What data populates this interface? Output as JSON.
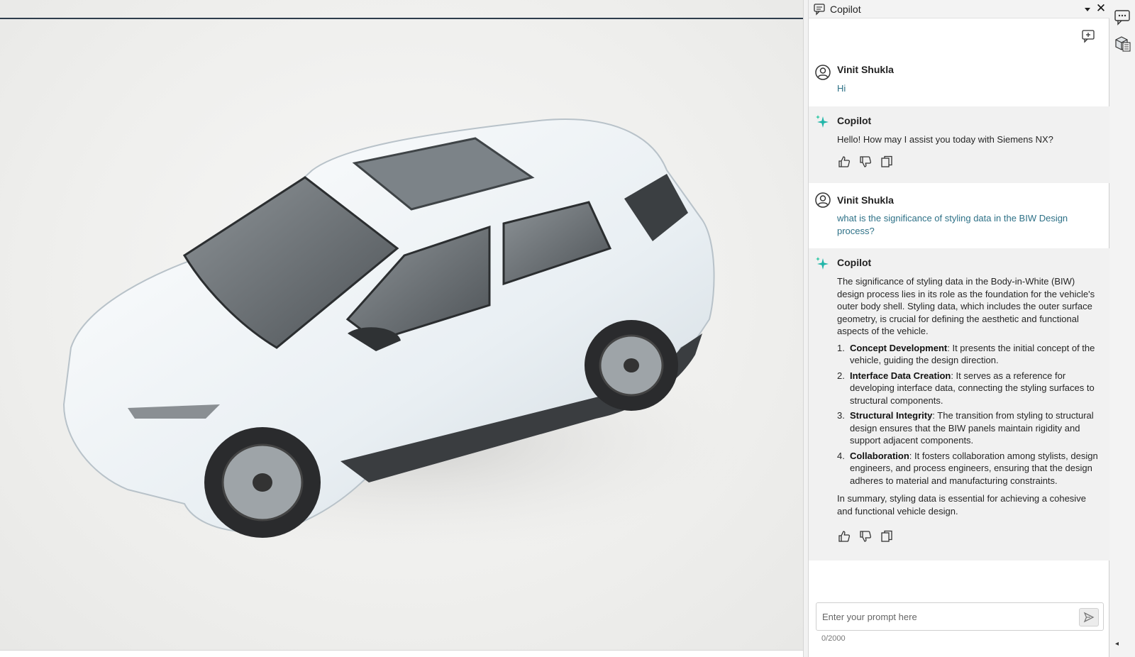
{
  "panel": {
    "title": "Copilot"
  },
  "messages": [
    {
      "role": "user",
      "name": "Vinit Shukla",
      "text": "Hi"
    },
    {
      "role": "bot",
      "name": "Copilot",
      "text": "Hello! How may I assist you today with Siemens NX?"
    },
    {
      "role": "user",
      "name": "Vinit Shukla",
      "text": "what is the significance of styling data in the BIW Design process?"
    },
    {
      "role": "bot",
      "name": "Copilot",
      "intro": "The significance of styling data in the Body-in-White (BIW) design process lies in its role as the foundation for the vehicle's outer body shell. Styling data, which includes the outer surface geometry, is crucial for defining the aesthetic and functional aspects of the vehicle.",
      "list": [
        {
          "num": "1.",
          "term": "Concept Development",
          "desc": ": It presents the initial concept of the vehicle, guiding the design direction."
        },
        {
          "num": "2.",
          "term": "Interface Data Creation",
          "desc": ": It serves as a reference for developing interface data, connecting the styling surfaces to structural components."
        },
        {
          "num": "3.",
          "term": "Structural Integrity",
          "desc": ": The transition from styling to structural design ensures that the BIW panels maintain rigidity and support adjacent components."
        },
        {
          "num": "4.",
          "term": "Collaboration",
          "desc": ": It fosters collaboration among stylists, design engineers, and process engineers, ensuring that the design adheres to material and manufacturing constraints."
        }
      ],
      "summary": "In summary, styling data is essential for achieving a cohesive and functional vehicle design."
    }
  ],
  "prompt": {
    "placeholder": "Enter your prompt here",
    "char_count": "0/2000"
  },
  "icons": {
    "header": "chat-icon",
    "dropdown": "chevron-down-icon",
    "close": "close-icon",
    "new_chat": "new-chat-icon",
    "user_avatar": "user-avatar-icon",
    "bot_avatar": "sparkle-icon",
    "like": "thumbs-up-icon",
    "dislike": "thumbs-down-icon",
    "copy": "copy-icon",
    "send": "send-icon",
    "rail": [
      "copilot-chat-icon",
      "part-navigator-icon"
    ]
  },
  "colors": {
    "user_text": "#2e7187",
    "sparkle": "#1fb5a8",
    "viewport_line": "#2e3d4c"
  }
}
